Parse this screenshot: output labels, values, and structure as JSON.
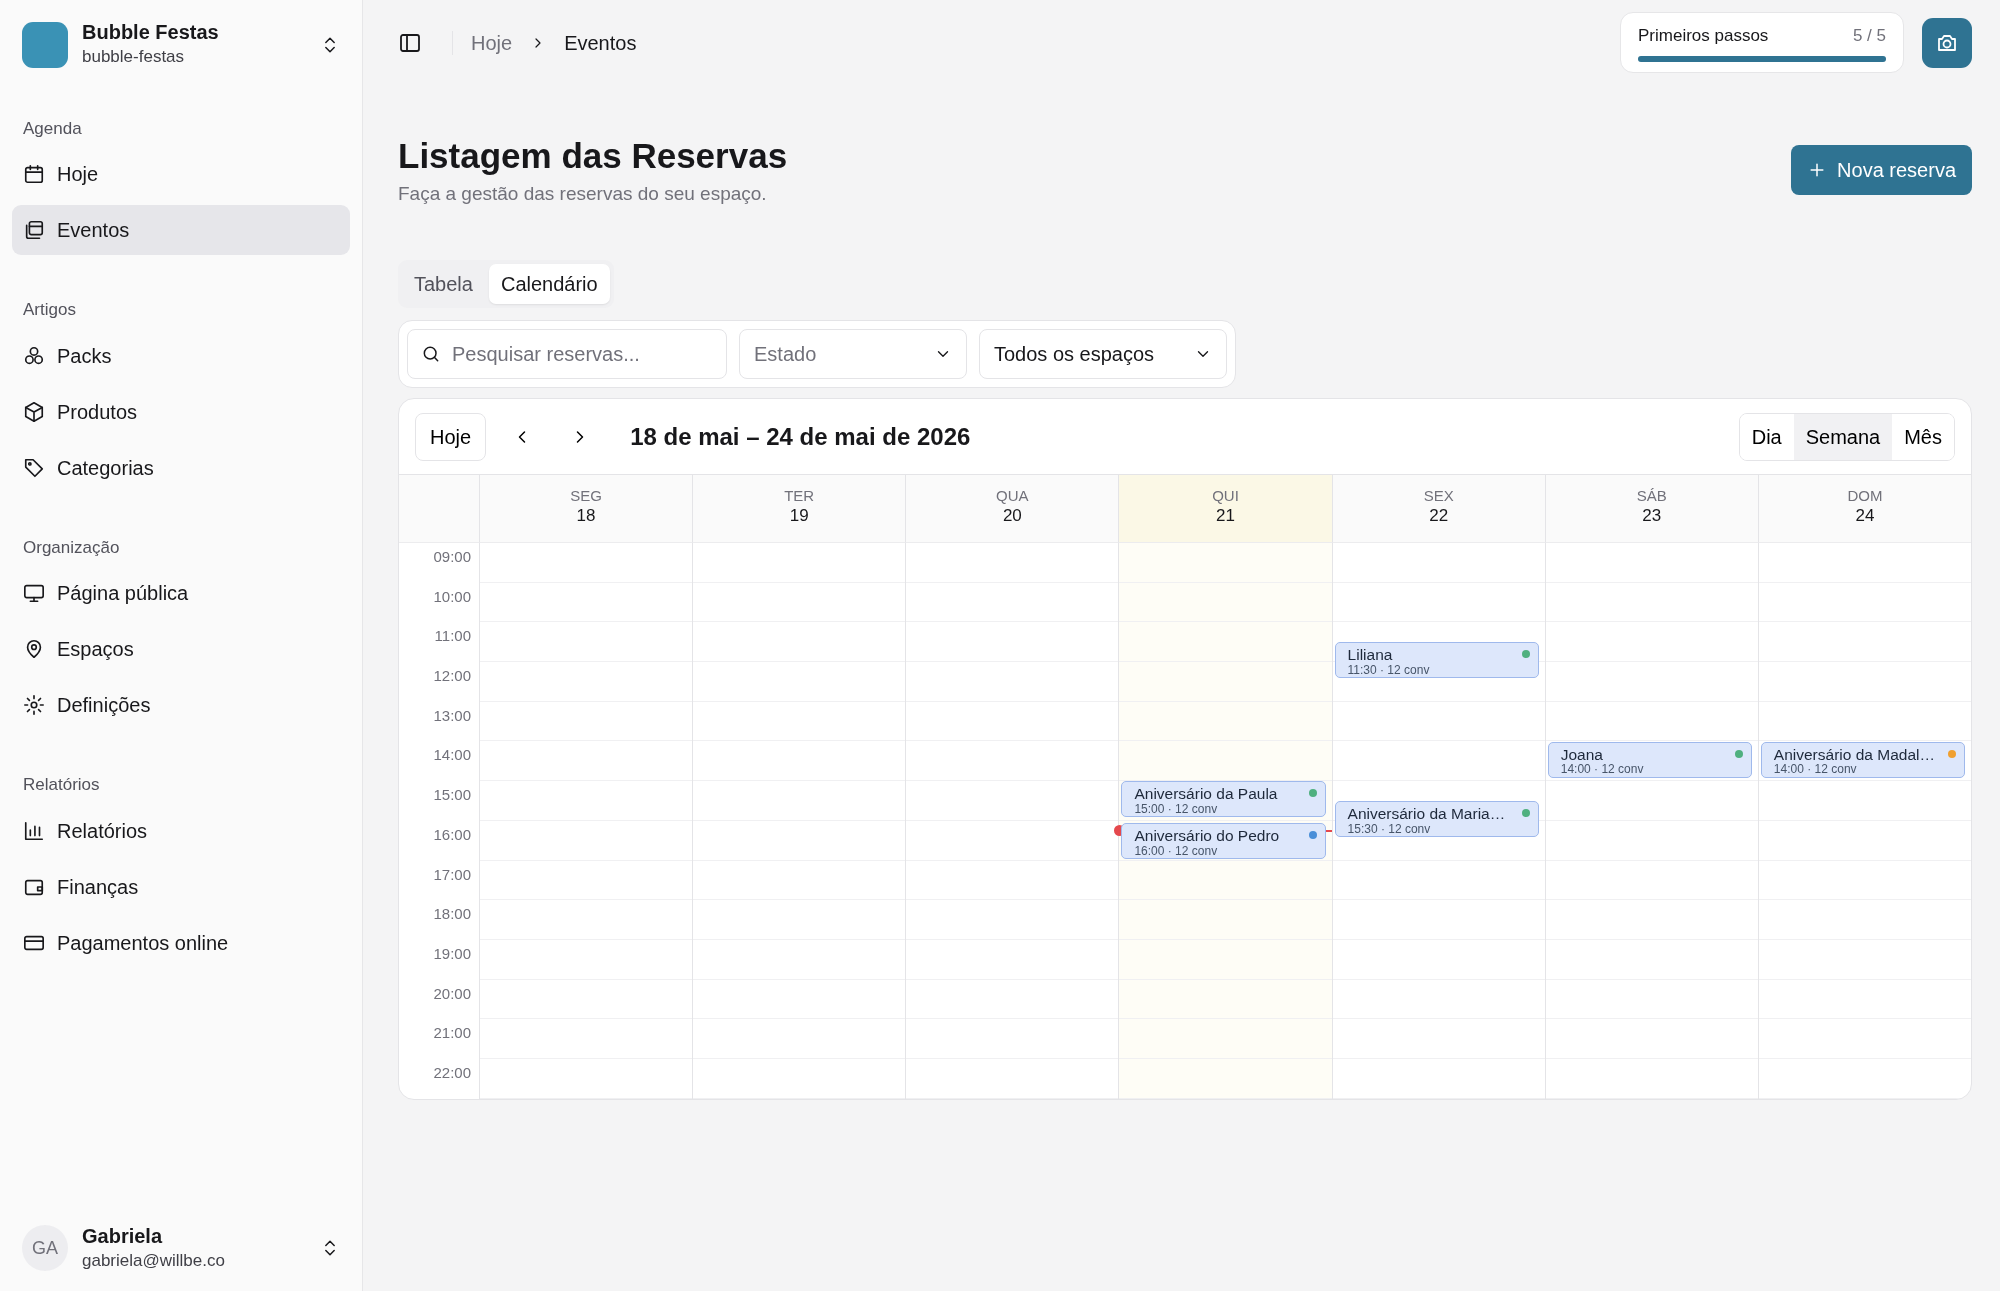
{
  "workspace": {
    "name": "Bubble Festas",
    "slug": "bubble-festas"
  },
  "sidebar": {
    "sections": [
      {
        "title": "Agenda",
        "items": [
          {
            "label": "Hoje",
            "selected": false
          },
          {
            "label": "Eventos",
            "selected": true
          }
        ]
      },
      {
        "title": "Artigos",
        "items": [
          {
            "label": "Packs",
            "selected": false
          },
          {
            "label": "Produtos",
            "selected": false
          },
          {
            "label": "Categorias",
            "selected": false
          }
        ]
      },
      {
        "title": "Organização",
        "items": [
          {
            "label": "Página pública",
            "selected": false
          },
          {
            "label": "Espaços",
            "selected": false
          },
          {
            "label": "Definições",
            "selected": false
          }
        ]
      },
      {
        "title": "Relatórios",
        "items": [
          {
            "label": "Relatórios",
            "selected": false
          },
          {
            "label": "Finanças",
            "selected": false
          },
          {
            "label": "Pagamentos online",
            "selected": false
          }
        ]
      }
    ]
  },
  "user": {
    "initials": "GA",
    "name": "Gabriela",
    "email": "gabriela@willbe.co"
  },
  "breadcrumb": [
    "Hoje",
    "Eventos"
  ],
  "onboarding": {
    "label": "Primeiros passos",
    "count": "5 / 5",
    "level": 1
  },
  "page": {
    "title": "Listagem das Reservas",
    "subtitle": "Faça a gestão das reservas do seu espaço.",
    "new_button": "Nova reserva"
  },
  "tabs": [
    {
      "label": "Tabela",
      "selected": false
    },
    {
      "label": "Calendário",
      "selected": true
    }
  ],
  "filters": {
    "search": {
      "placeholder": "Pesquisar reservas..."
    },
    "status": "Estado",
    "space": "Todos os espaços"
  },
  "calendar": {
    "today_button": "Hoje",
    "range": "18 de mai – 24 de mai de 2026",
    "views": [
      {
        "label": "Dia",
        "selected": false
      },
      {
        "label": "Semana",
        "selected": true
      },
      {
        "label": "Mês",
        "selected": false
      }
    ],
    "hours": [
      "09:00",
      "10:00",
      "11:00",
      "12:00",
      "13:00",
      "14:00",
      "15:00",
      "16:00",
      "17:00",
      "18:00",
      "19:00",
      "20:00",
      "21:00",
      "22:00"
    ],
    "days": [
      {
        "name": "SEG",
        "date": "18",
        "today": false
      },
      {
        "name": "TER",
        "date": "19",
        "today": false
      },
      {
        "name": "QUA",
        "date": "20",
        "today": false
      },
      {
        "name": "QUI",
        "date": "21",
        "today": true,
        "events": [
          {
            "title": "Aniversário da Paula",
            "subtitle": "15:00 · 12 conv",
            "color": "#4fb07f"
          },
          {
            "title": "Aniversário do Pedro",
            "subtitle": "16:00 · 12 conv",
            "color": "#4a8fd8"
          }
        ]
      },
      {
        "name": "SEX",
        "date": "22",
        "today": false,
        "events": [
          {
            "title": "Liliana",
            "subtitle": "11:30 · 12 conv",
            "color": "#4fb07f"
          },
          {
            "title": "Aniversário da Maria…",
            "subtitle": "15:30 · 12 conv",
            "color": "#4fb07f"
          }
        ]
      },
      {
        "name": "SÁB",
        "date": "23",
        "today": false,
        "events": [
          {
            "title": "Joana",
            "subtitle": "14:00 · 12 conv",
            "color": "#4fb07f"
          }
        ]
      },
      {
        "name": "DOM",
        "date": "24",
        "today": false,
        "events": [
          {
            "title": "Aniversário da Madal…",
            "subtitle": "14:00 · 12 conv",
            "color": "#f0a030"
          }
        ]
      }
    ]
  }
}
